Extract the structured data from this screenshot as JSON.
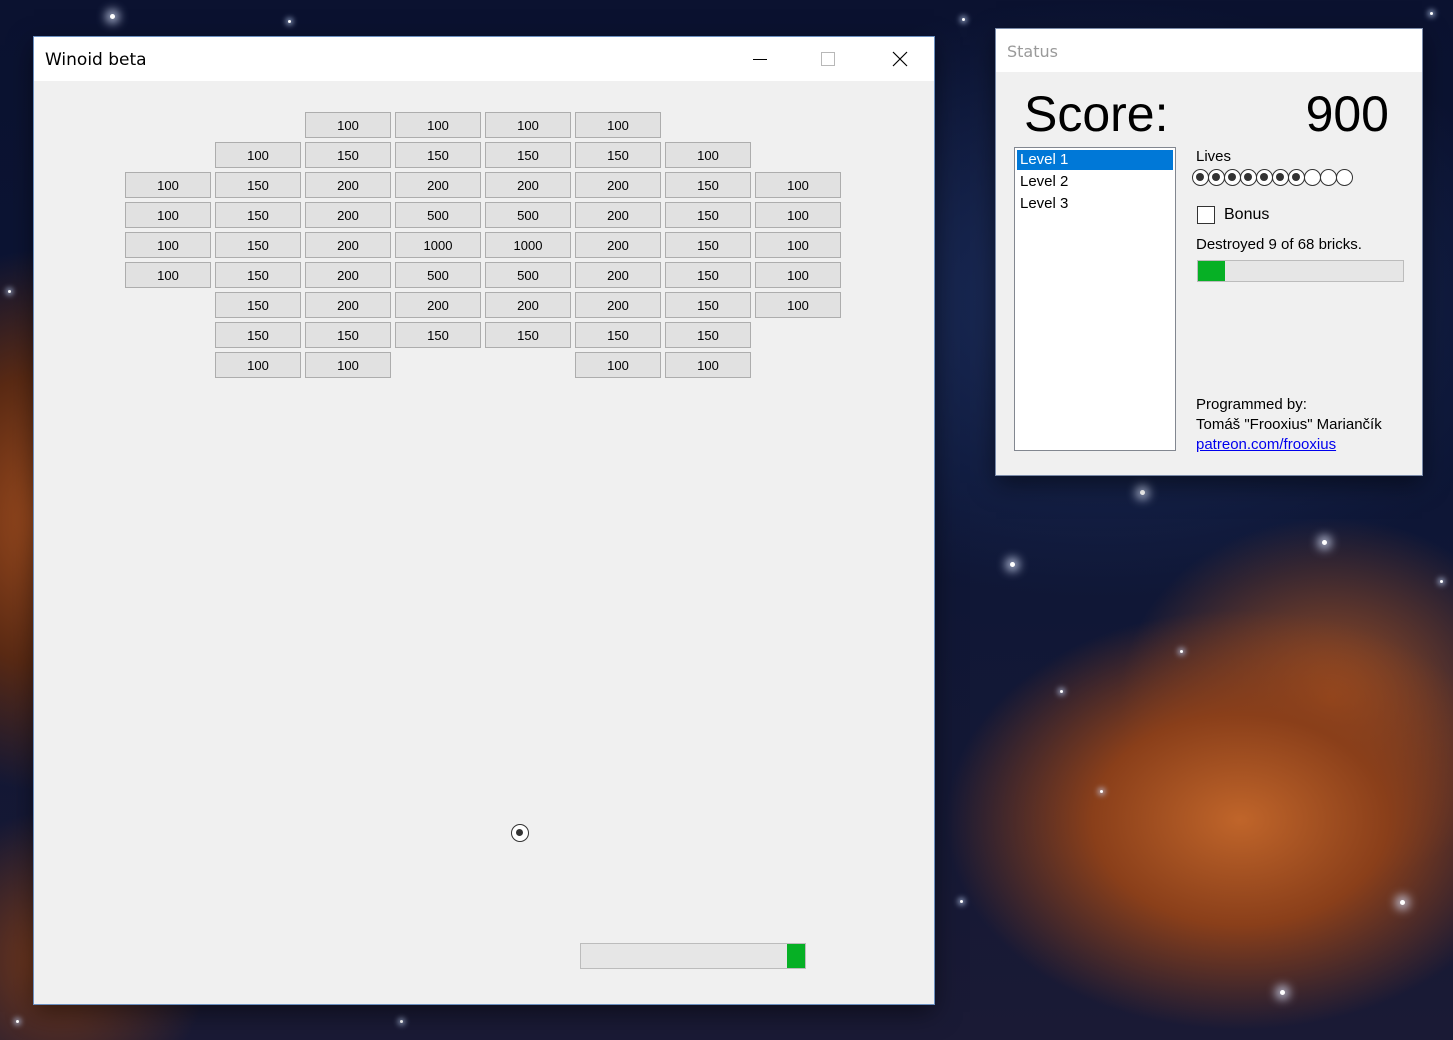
{
  "main_window": {
    "title": "Winoid beta",
    "bricks": [
      [
        "",
        "",
        "100",
        "100",
        "100",
        "100",
        "",
        ""
      ],
      [
        "",
        "100",
        "150",
        "150",
        "150",
        "150",
        "100",
        ""
      ],
      [
        "100",
        "150",
        "200",
        "200",
        "200",
        "200",
        "150",
        "100"
      ],
      [
        "100",
        "150",
        "200",
        "500",
        "500",
        "200",
        "150",
        "100"
      ],
      [
        "100",
        "150",
        "200",
        "1000",
        "1000",
        "200",
        "150",
        "100"
      ],
      [
        "100",
        "150",
        "200",
        "500",
        "500",
        "200",
        "150",
        "100"
      ],
      [
        "",
        "150",
        "200",
        "200",
        "200",
        "200",
        "150",
        "100"
      ],
      [
        "",
        "150",
        "150",
        "150",
        "150",
        "150",
        "150",
        ""
      ],
      [
        "",
        "100",
        "100",
        "",
        "",
        "100",
        "100",
        ""
      ]
    ],
    "paddle_highlight_fraction": [
      0.92,
      1.0
    ]
  },
  "status_window": {
    "title": "Status",
    "score_label": "Score:",
    "score_value": "900",
    "levels": [
      "Level 1",
      "Level 2",
      "Level 3"
    ],
    "selected_level": 0,
    "lives_label": "Lives",
    "lives_total": 10,
    "lives_remaining": 7,
    "bonus_label": "Bonus",
    "bonus_checked": false,
    "destroyed_text": "Destroyed 9 of 68 bricks.",
    "destroyed_count": 9,
    "total_bricks": 68,
    "programmed_by_label": "Programmed by:",
    "author": "Tomáš \"Frooxius\" Mariančík",
    "link_text": "patreon.com/frooxius",
    "progress_color": "#06b025",
    "selection_color": "#0078d7"
  }
}
